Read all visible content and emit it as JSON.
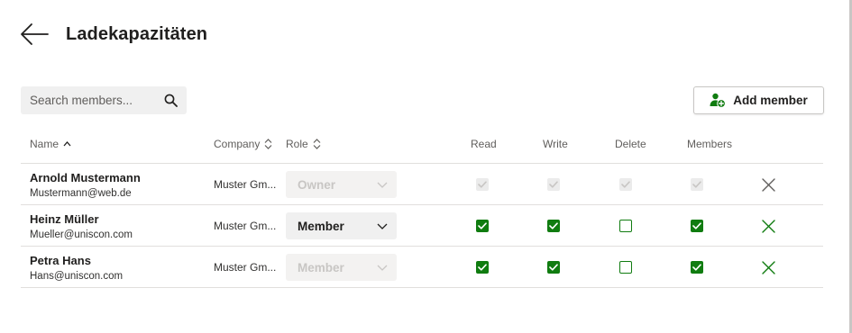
{
  "page": {
    "title": "Ladekapazitäten"
  },
  "search": {
    "placeholder": "Search members..."
  },
  "add_member": {
    "label": "Add member"
  },
  "columns": {
    "name": "Name",
    "company": "Company",
    "role": "Role",
    "read": "Read",
    "write": "Write",
    "delete": "Delete",
    "members": "Members"
  },
  "sort": {
    "column": "Name",
    "direction": "ascending"
  },
  "colors": {
    "accent_green": "#107c10",
    "disabled_grey": "#c8c6c4",
    "text": "#201f1e",
    "divider": "#e1dfdd"
  },
  "members": [
    {
      "name": "Arnold Mustermann",
      "email": "Mustermann@web.de",
      "company": "Muster Gm...",
      "role": "Owner",
      "role_editable": false,
      "read": true,
      "write": true,
      "delete": true,
      "members": true,
      "permissions_editable": false,
      "removable": false
    },
    {
      "name": "Heinz Müller",
      "email": "Mueller@uniscon.com",
      "company": "Muster Gm...",
      "role": "Member",
      "role_editable": true,
      "read": true,
      "write": true,
      "delete": false,
      "members": true,
      "permissions_editable": true,
      "removable": true
    },
    {
      "name": "Petra Hans",
      "email": "Hans@uniscon.com",
      "company": "Muster Gm...",
      "role": "Member",
      "role_editable": false,
      "read": true,
      "write": true,
      "delete": false,
      "members": true,
      "permissions_editable": true,
      "removable": true
    }
  ]
}
